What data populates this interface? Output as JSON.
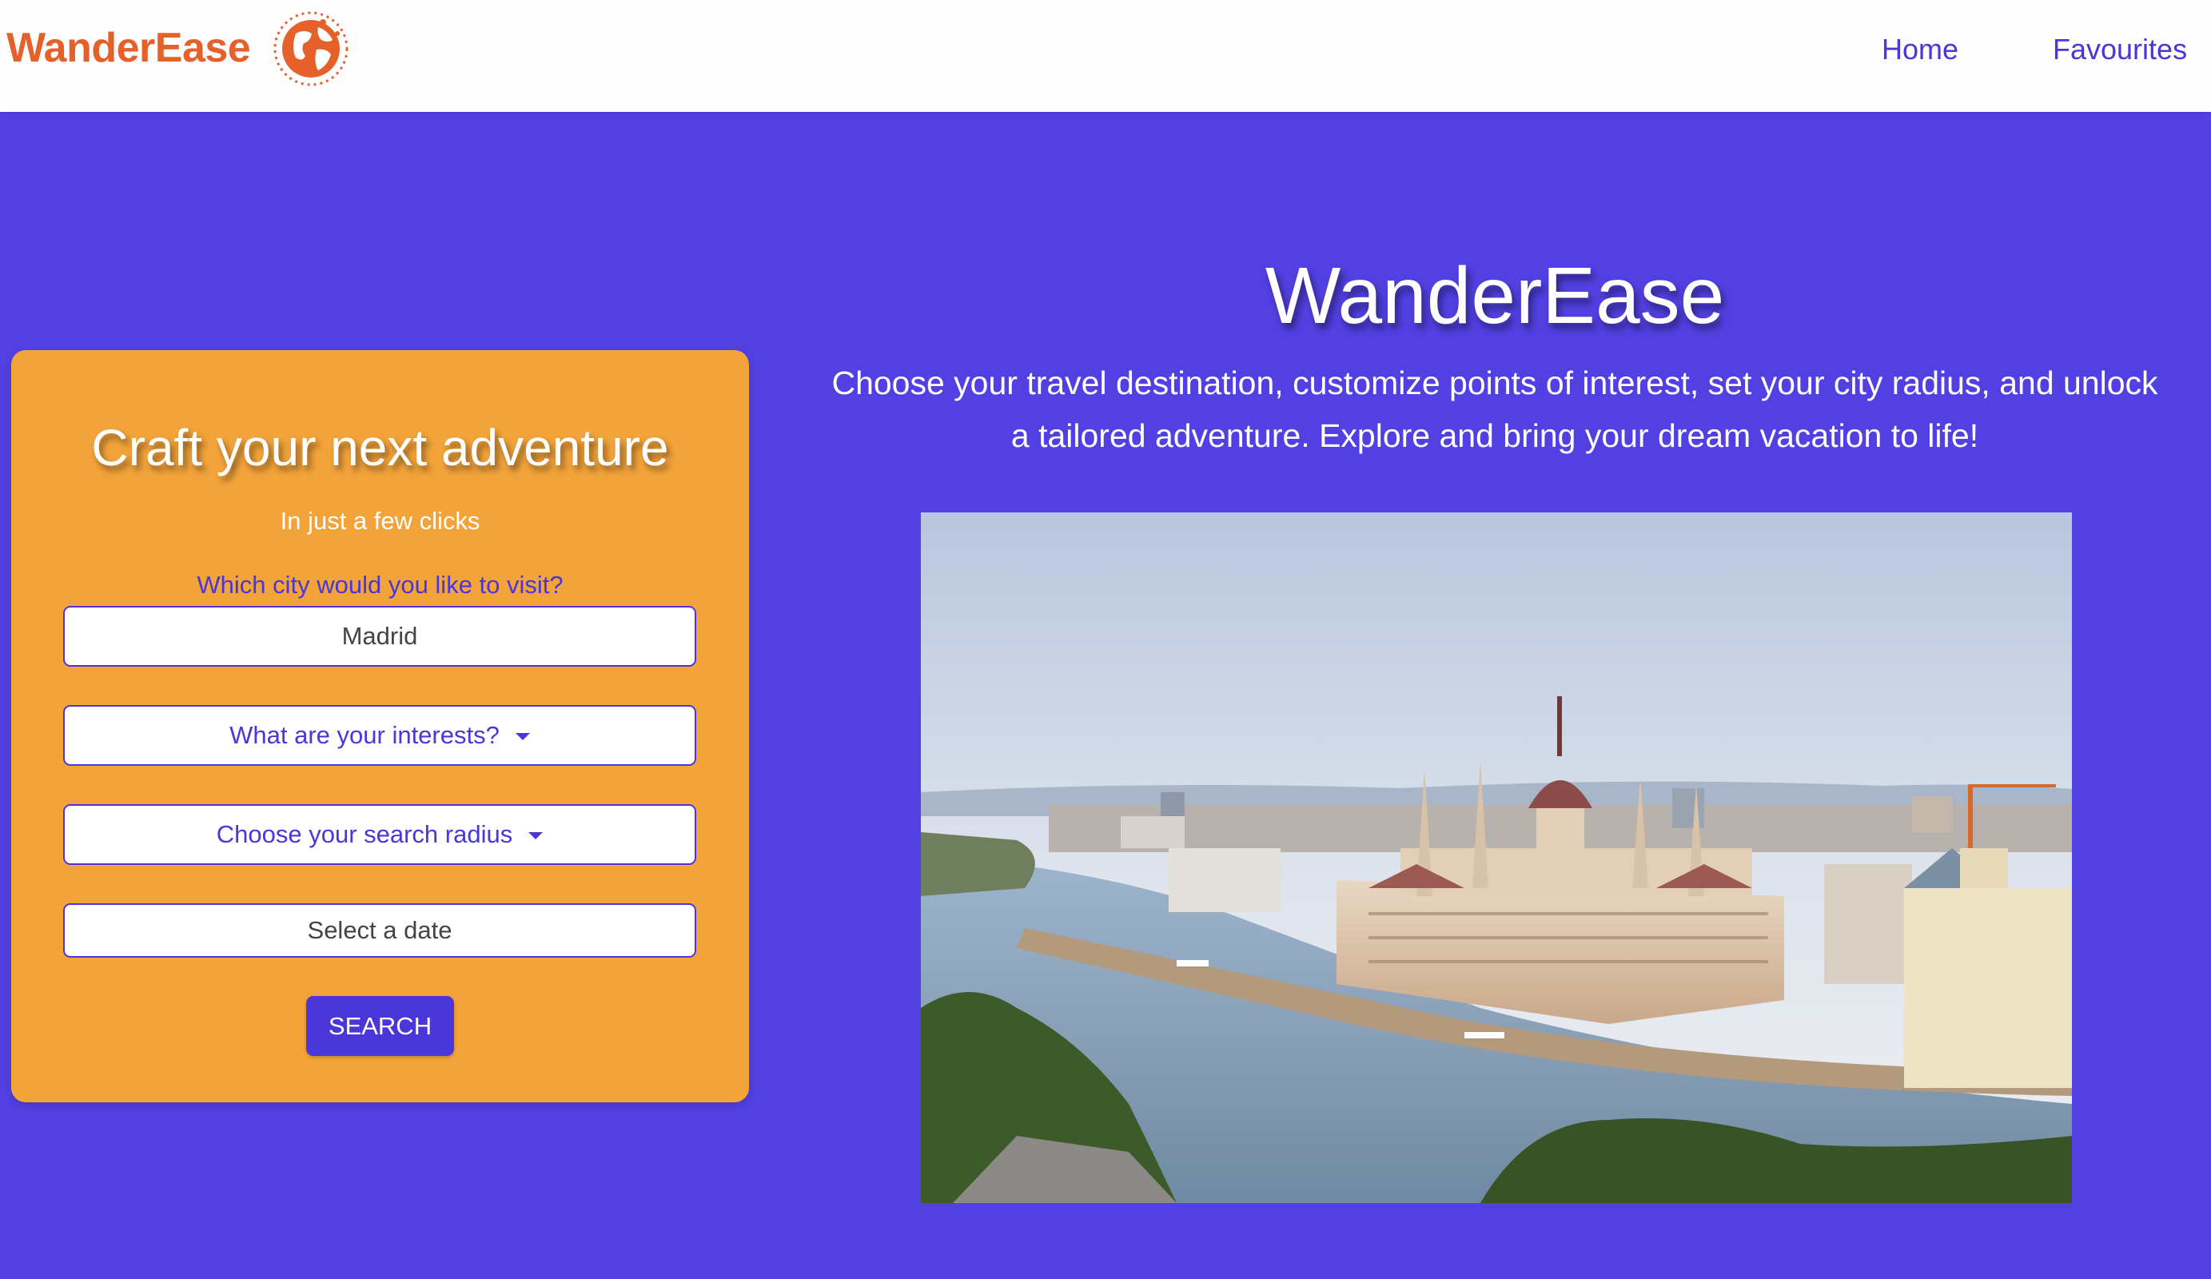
{
  "navbar": {
    "brand": "WanderEase",
    "logo_icon": "globe-icon",
    "links": [
      "Home",
      "Favourites"
    ]
  },
  "search_card": {
    "title": "Craft your next adventure",
    "subtitle": "In just a few clicks",
    "city_label": "Which city would you like to visit?",
    "city_value": "Madrid",
    "interests_label": "What are your interests?",
    "radius_label": "Choose your search radius",
    "date_placeholder": "Select a date",
    "search_button": "SEARCH"
  },
  "hero": {
    "title": "WanderEase",
    "description": "Choose your travel destination, customize points of interest, set your city radius, and unlock a tailored adventure. Explore and bring your dream vacation to life!",
    "image_subject": "riverside-parliament-photo"
  },
  "colors": {
    "brand_orange": "#e6602a",
    "accent_purple": "#5240e2",
    "link_purple": "#4a36d9",
    "card_orange": "#f2a33a",
    "white": "#ffffff"
  }
}
